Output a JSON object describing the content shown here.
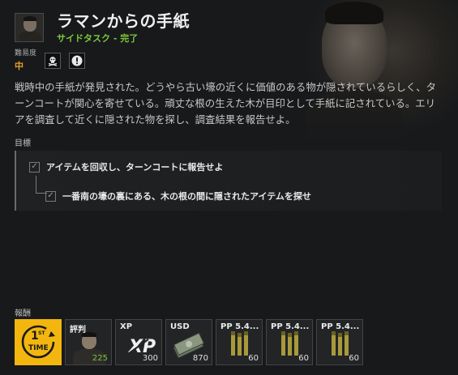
{
  "quest": {
    "title": "ラマンからの手紙",
    "subtitle": "サイドタスク - 完了",
    "difficulty_label": "難易度",
    "difficulty_value": "中",
    "description": "戦時中の手紙が発見された。どうやら古い壕の近くに価値のある物が隠されているらしく、ターンコートが関心を寄せている。頑丈な根の生えた木が目印として手紙に記されている。エリアを調査して近くに隠された物を探し、調査結果を報告せよ。"
  },
  "icons": [
    "skull-crossbones-icon",
    "alert-exclamation-icon"
  ],
  "objectives": {
    "label": "目標",
    "items": [
      {
        "text": "アイテムを回収し、ターンコートに報告せよ",
        "completed": true
      },
      {
        "text": "一番南の壕の裏にある、木の根の間に隠されたアイテムを探せ",
        "completed": true
      }
    ]
  },
  "rewards": {
    "label": "報酬",
    "items": [
      {
        "icon": "first-time-icon",
        "badge_top": "1",
        "badge_sup": "ST",
        "badge_bottom": "TIME"
      },
      {
        "name": "評判",
        "quantity": "225",
        "icon": "person-icon"
      },
      {
        "name": "XP",
        "quantity": "300",
        "icon": "xp-icon"
      },
      {
        "name": "USD",
        "quantity": "870",
        "icon": "cash-icon"
      },
      {
        "name": "PP 5.4...",
        "quantity": "60",
        "icon": "ammo-icon"
      },
      {
        "name": "PP 5.4...",
        "quantity": "60",
        "icon": "ammo-icon"
      },
      {
        "name": "PP 5.4...",
        "quantity": "60",
        "icon": "ammo-icon"
      }
    ]
  },
  "colors": {
    "completed_green": "#7ec83a",
    "difficulty_orange": "#e8a020",
    "first_time_yellow": "#f2b60f"
  }
}
